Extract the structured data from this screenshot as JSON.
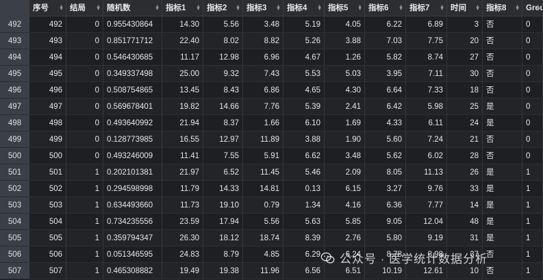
{
  "columns": [
    "",
    "序号",
    "结局",
    "随机数",
    "指标1",
    "指标2",
    "指标3",
    "指标4",
    "指标5",
    "指标6",
    "指标7",
    "时间",
    "指标8",
    "Group"
  ],
  "rows": [
    [
      "492",
      "492",
      "0",
      "0.955430864",
      "14.30",
      "5.56",
      "3.48",
      "5.19",
      "4.05",
      "6.22",
      "6.89",
      "3",
      "否",
      "0"
    ],
    [
      "493",
      "493",
      "0",
      "0.851771712",
      "22.40",
      "8.02",
      "8.82",
      "5.26",
      "3.88",
      "7.03",
      "7.75",
      "20",
      "否",
      "0"
    ],
    [
      "494",
      "494",
      "0",
      "0.546430685",
      "11.17",
      "12.98",
      "6.96",
      "4.67",
      "1.26",
      "5.82",
      "8.74",
      "27",
      "否",
      "0"
    ],
    [
      "495",
      "495",
      "0",
      "0.349337498",
      "25.00",
      "9.32",
      "7.43",
      "5.53",
      "5.03",
      "3.95",
      "7.11",
      "30",
      "否",
      "0"
    ],
    [
      "496",
      "496",
      "0",
      "0.508754865",
      "13.45",
      "8.43",
      "6.86",
      "4.65",
      "4.30",
      "6.64",
      "7.33",
      "18",
      "否",
      "0"
    ],
    [
      "497",
      "497",
      "0",
      "0.569678401",
      "19.82",
      "14.66",
      "7.76",
      "5.39",
      "2.41",
      "6.42",
      "5.98",
      "25",
      "是",
      "0"
    ],
    [
      "498",
      "498",
      "0",
      "0.493640992",
      "21.94",
      "8.37",
      "1.66",
      "6.10",
      "1.69",
      "4.33",
      "6.11",
      "24",
      "是",
      "0"
    ],
    [
      "499",
      "499",
      "0",
      "0.128773985",
      "16.55",
      "12.97",
      "11.89",
      "3.88",
      "1.90",
      "5.60",
      "7.24",
      "21",
      "否",
      "0"
    ],
    [
      "500",
      "500",
      "0",
      "0.493246009",
      "11.41",
      "7.55",
      "5.91",
      "6.62",
      "3.48",
      "5.62",
      "6.02",
      "28",
      "否",
      "0"
    ],
    [
      "501",
      "501",
      "1",
      "0.202101381",
      "21.97",
      "6.52",
      "11.45",
      "5.46",
      "2.09",
      "8.05",
      "11.13",
      "26",
      "是",
      "1"
    ],
    [
      "502",
      "502",
      "1",
      "0.294598998",
      "11.79",
      "14.33",
      "14.81",
      "0.13",
      "6.15",
      "3.27",
      "9.76",
      "33",
      "是",
      "1"
    ],
    [
      "503",
      "503",
      "1",
      "0.634493660",
      "11.73",
      "19.10",
      "0.79",
      "1.34",
      "4.16",
      "6.36",
      "7.77",
      "14",
      "是",
      "1"
    ],
    [
      "504",
      "504",
      "1",
      "0.734235556",
      "23.59",
      "17.94",
      "5.56",
      "5.63",
      "5.85",
      "9.05",
      "12.04",
      "48",
      "是",
      "1"
    ],
    [
      "505",
      "505",
      "1",
      "0.359794347",
      "26.30",
      "18.12",
      "18.74",
      "8.39",
      "2.76",
      "5.80",
      "9.19",
      "31",
      "是",
      "1"
    ],
    [
      "506",
      "506",
      "1",
      "0.051346595",
      "24.83",
      "8.79",
      "4.85",
      "6.29",
      "6.24",
      "8.78",
      "8.98",
      "37",
      "否",
      "1"
    ],
    [
      "507",
      "507",
      "1",
      "0.465308882",
      "19.49",
      "19.38",
      "11.96",
      "6.56",
      "6.51",
      "10.19",
      "12.61",
      "10",
      "否",
      "1"
    ]
  ],
  "watermark": "公众号 · 医学统计数据分析"
}
